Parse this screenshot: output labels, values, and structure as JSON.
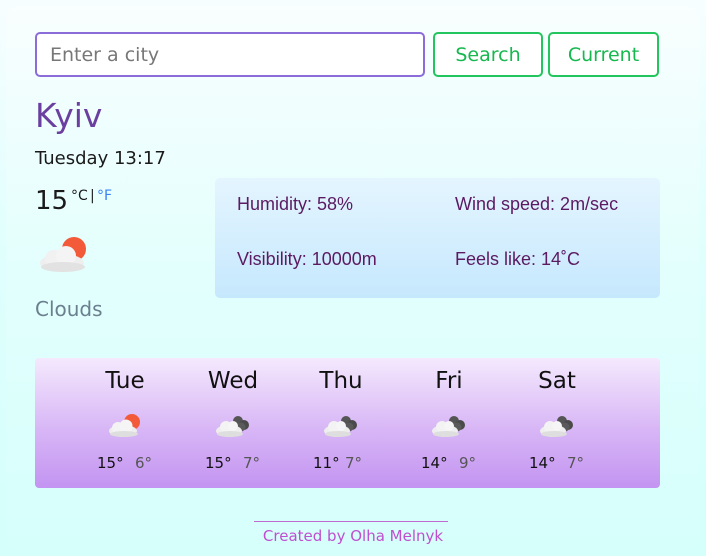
{
  "search": {
    "placeholder": "Enter a city",
    "value": ""
  },
  "buttons": {
    "search": "Search",
    "current": "Current"
  },
  "city": "Kyiv",
  "datetime": "Tuesday 13:17",
  "temperature": {
    "value": "15",
    "unit_c": "°C",
    "separator": "|",
    "unit_f": "°F"
  },
  "weather": {
    "icon": "sun-behind-cloud-icon",
    "description": "Clouds"
  },
  "details": {
    "humidity": "Humidity: 58%",
    "wind": "Wind speed: 2m/sec",
    "visibility": "Visibility: 10000m",
    "feels_like": "Feels like: 14˚C"
  },
  "forecast": [
    {
      "day": "Tue",
      "icon": "sun-behind-cloud-icon",
      "max": "15°",
      "min": "6°"
    },
    {
      "day": "Wed",
      "icon": "clouds-icon",
      "max": "15°",
      "min": "7°"
    },
    {
      "day": "Thu",
      "icon": "clouds-icon",
      "max": "11°",
      "min": "7°"
    },
    {
      "day": "Fri",
      "icon": "clouds-icon",
      "max": "14°",
      "min": "9°"
    },
    {
      "day": "Sat",
      "icon": "clouds-icon",
      "max": "14°",
      "min": "7°"
    }
  ],
  "footer": {
    "credit": "Created by Olha Melnyk"
  },
  "colors": {
    "accent_green": "#22c55e",
    "city_purple": "#6b3fa0",
    "details_text": "#5b1a61",
    "footer_pink": "#c04fcf",
    "fahrenheit_link": "#3b82f6"
  }
}
